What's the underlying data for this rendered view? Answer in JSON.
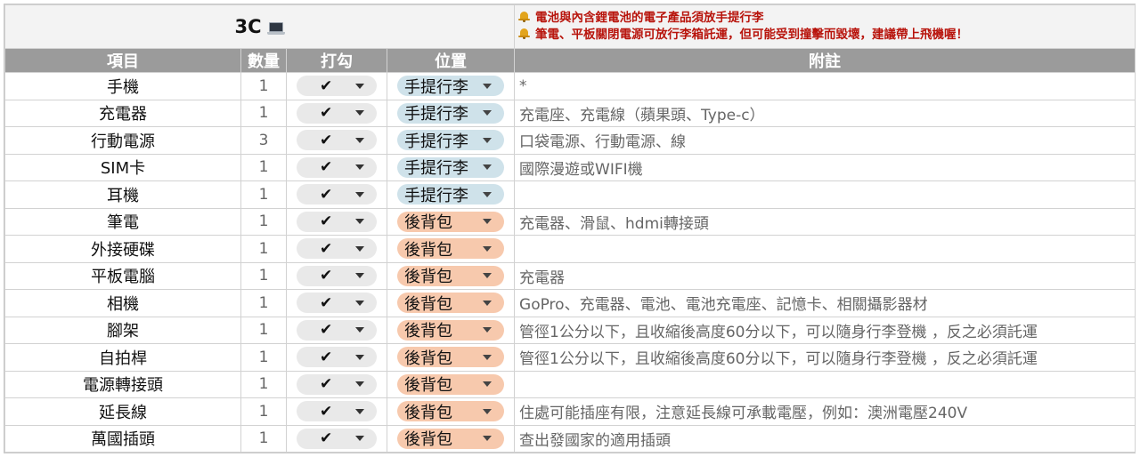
{
  "title": "3C",
  "title_icon": "laptop-icon",
  "notes": [
    "電池與內含鋰電池的電子產品須放手提行李",
    "筆電、平板關閉電源可放行李箱託運，但可能受到撞擊而毀壞，建議帶上飛機喔！"
  ],
  "note_icon": "bell-icon",
  "columns": {
    "item": "項目",
    "qty": "數量",
    "check": "打勾",
    "location": "位置",
    "remark": "附註"
  },
  "location_colors": {
    "手提行李": "#cfe2ea",
    "後背包": "#f7c9ad"
  },
  "rows": [
    {
      "item": "手機",
      "qty": "1",
      "check": "✔",
      "location": "手提行李",
      "remark": "*"
    },
    {
      "item": "充電器",
      "qty": "1",
      "check": "✔",
      "location": "手提行李",
      "remark": "充電座、充電線（蘋果頭、Type-c）"
    },
    {
      "item": "行動電源",
      "qty": "3",
      "check": "✔",
      "location": "手提行李",
      "remark": "口袋電源、行動電源、線"
    },
    {
      "item": "SIM卡",
      "qty": "1",
      "check": "✔",
      "location": "手提行李",
      "remark": "國際漫遊或WIFI機"
    },
    {
      "item": "耳機",
      "qty": "1",
      "check": "✔",
      "location": "手提行李",
      "remark": ""
    },
    {
      "item": "筆電",
      "qty": "1",
      "check": "✔",
      "location": "後背包",
      "remark": "充電器、滑鼠、hdmi轉接頭"
    },
    {
      "item": "外接硬碟",
      "qty": "1",
      "check": "✔",
      "location": "後背包",
      "remark": ""
    },
    {
      "item": "平板電腦",
      "qty": "1",
      "check": "✔",
      "location": "後背包",
      "remark": "充電器"
    },
    {
      "item": "相機",
      "qty": "1",
      "check": "✔",
      "location": "後背包",
      "remark": "GoPro、充電器、電池、電池充電座、記憶卡、相關攝影器材"
    },
    {
      "item": "腳架",
      "qty": "1",
      "check": "✔",
      "location": "後背包",
      "remark": "管徑1公分以下，且收縮後高度60分以下，可以隨身行李登機 ，反之必須託運"
    },
    {
      "item": "自拍桿",
      "qty": "1",
      "check": "✔",
      "location": "後背包",
      "remark": "管徑1公分以下，且收縮後高度60分以下，可以隨身行李登機 ，反之必須託運"
    },
    {
      "item": "電源轉接頭",
      "qty": "1",
      "check": "✔",
      "location": "後背包",
      "remark": ""
    },
    {
      "item": "延長線",
      "qty": "1",
      "check": "✔",
      "location": "後背包",
      "remark": "住處可能插座有限，注意延長線可承載電壓，例如：澳洲電壓240V"
    },
    {
      "item": "萬國插頭",
      "qty": "1",
      "check": "✔",
      "location": "後背包",
      "remark": "查出發國家的適用插頭"
    }
  ]
}
